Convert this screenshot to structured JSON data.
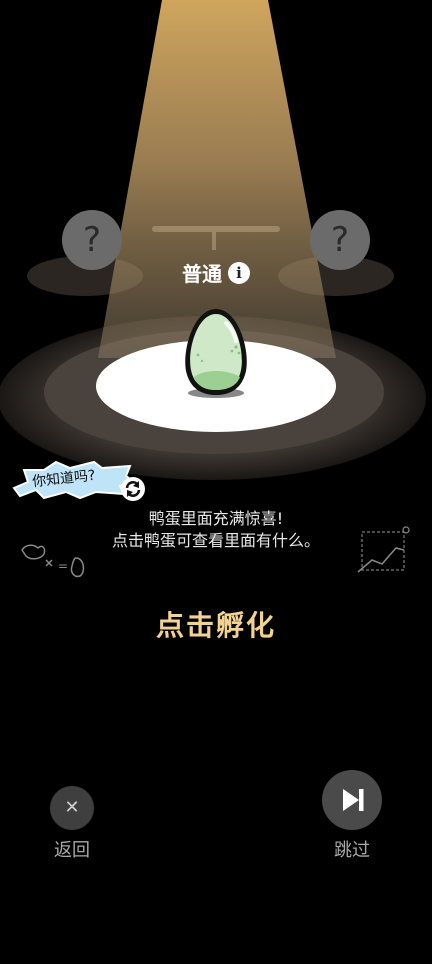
{
  "rarity": {
    "label": "普通",
    "info_icon": "info-icon"
  },
  "mystery_slots": [
    {
      "symbol": "?"
    },
    {
      "symbol": "?"
    }
  ],
  "tip": {
    "badge": "你知道吗?",
    "line1": "鸭蛋里面充满惊喜!",
    "line2": "点击鸭蛋可查看里面有什么。",
    "refresh_icon": "refresh-icon"
  },
  "doodle": {
    "equals_text": "="
  },
  "hatch_label": "点击孵化",
  "controls": {
    "back_label": "返回",
    "back_icon": "close-icon",
    "skip_label": "跳过",
    "skip_icon": "skip-next-icon"
  },
  "colors": {
    "spotlight": "#e8c47a",
    "hatch_text": "#f3d392",
    "egg": "#cfe8c8"
  }
}
